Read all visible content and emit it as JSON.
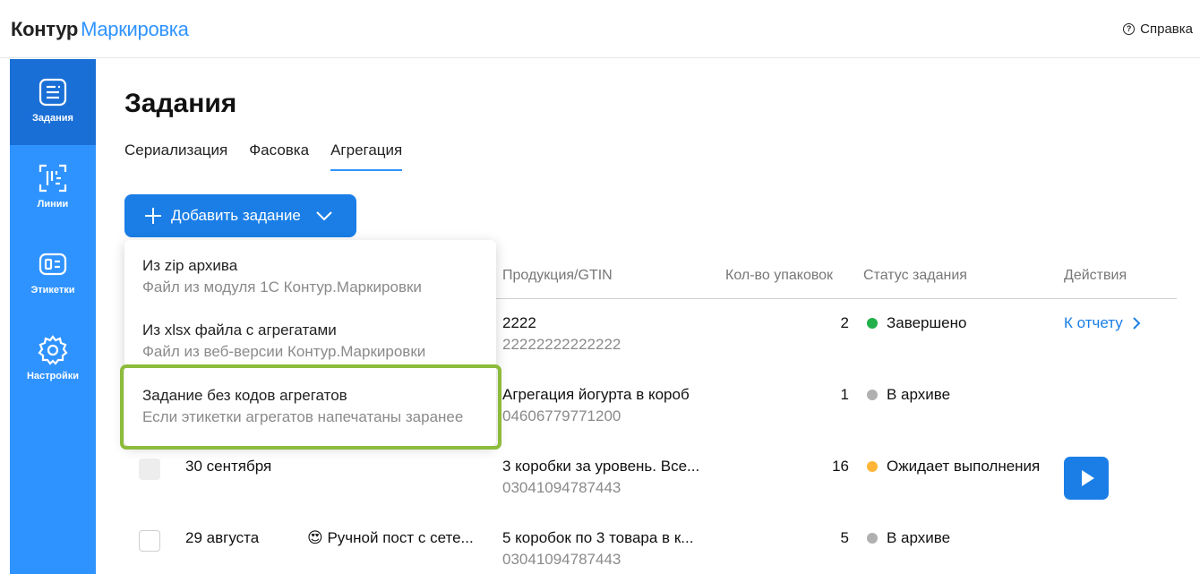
{
  "header": {
    "brand": "Контур",
    "product": "Маркировка",
    "help": "Справка"
  },
  "sidebar": {
    "items": [
      {
        "label": "Задания",
        "icon": "tasks-icon",
        "active": true
      },
      {
        "label": "Линии",
        "icon": "lines-icon",
        "active": false
      },
      {
        "label": "Этикетки",
        "icon": "label-icon",
        "active": false
      },
      {
        "label": "Настройки",
        "icon": "gear-icon",
        "active": false
      }
    ]
  },
  "page": {
    "title": "Задания",
    "tabs": [
      "Сериализация",
      "Фасовка",
      "Агрегация"
    ],
    "active_tab": "Агрегация",
    "add_button": "Добавить задание"
  },
  "table": {
    "headers": {
      "product": "Продукция/GTIN",
      "count": "Кол-во упаковок",
      "status": "Статус задания",
      "actions": "Действия"
    },
    "rows": [
      {
        "date": "",
        "line": "",
        "product": "2222",
        "gtin": "22222222222222",
        "count": "2",
        "status": "Завершено",
        "status_color": "#22b04b",
        "action": "К отчету"
      },
      {
        "date": "",
        "line": "",
        "product": "Агрегация йогурта в короб",
        "gtin": "04606779771200",
        "count": "1",
        "status": "В архиве",
        "status_color": "#b0b0b0",
        "action": ""
      },
      {
        "date": "30 сентября",
        "line": "",
        "product": "3 коробки за уровень. Все...",
        "gtin": "03041094787443",
        "count": "16",
        "status": "Ожидает выполнения",
        "status_color": "#ffb636",
        "action": "play"
      },
      {
        "date": "29 августа",
        "line": "😍 Ручной пост с сете...",
        "product": "5 коробок по 3 товара в к...",
        "gtin": "03041094787443",
        "count": "5",
        "status": "В архиве",
        "status_color": "#b0b0b0",
        "action": ""
      }
    ]
  },
  "dropdown": {
    "items": [
      {
        "title": "Из zip архива",
        "subtitle": "Файл из модуля 1С Контур.Маркировки"
      },
      {
        "title": "Из xlsx файла с агрегатами",
        "subtitle": "Файл из веб-версии Контур.Маркировки"
      },
      {
        "title": "Задание без кодов агрегатов",
        "subtitle": "Если этикетки агрегатов напечатаны заранее",
        "highlighted": true
      }
    ]
  },
  "colors": {
    "accent": "#2f93ff",
    "button": "#1a7ee6",
    "highlight": "#8dbb3c"
  }
}
